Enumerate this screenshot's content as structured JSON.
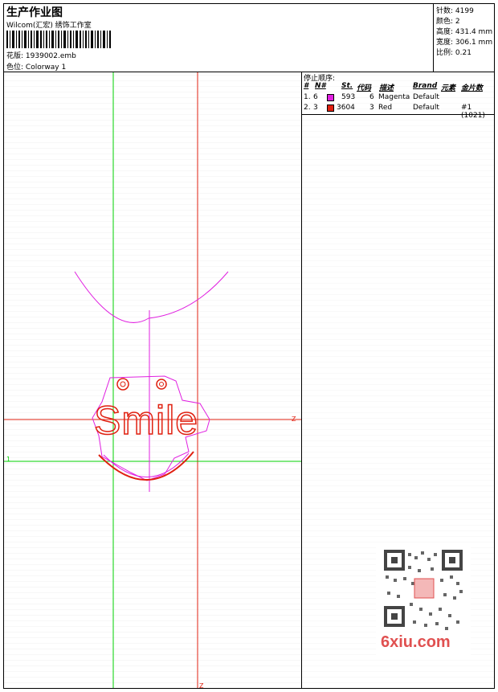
{
  "header": {
    "title": "生产作业图",
    "studio": "Wilcom(汇宏) 绣饰工作室",
    "design_label": "花版:",
    "design_file": "1939002.emb",
    "colorway_label": "色位:",
    "colorway": "Colorway 1"
  },
  "stats": {
    "stitches_label": "针数:",
    "stitches": "4199",
    "colors_label": "颜色:",
    "colors": "2",
    "height_label": "高度:",
    "height": "431.4 mm",
    "width_label": "宽度:",
    "width": "306.1 mm",
    "scale_label": "比例:",
    "scale": "0.21"
  },
  "stop_sequence": {
    "title": "停止顺序:",
    "headers": [
      "#",
      "N#",
      "St.",
      "代码",
      "描述",
      "Brand",
      "元素",
      "金片数"
    ],
    "rows": [
      {
        "idx": "1.",
        "n": "6",
        "color": "#e020e0",
        "st": "593",
        "code": "6",
        "desc": "Magenta",
        "brand": "Default",
        "element": "",
        "sequins": ""
      },
      {
        "idx": "2.",
        "n": "3",
        "color": "#e02010",
        "st": "3604",
        "code": "3",
        "desc": "Red",
        "brand": "Default",
        "element": "",
        "sequins": "#1 (1021)"
      }
    ]
  },
  "design_text": "Smile",
  "axis_labels": {
    "z_right": "Z",
    "z_bottom": "Z",
    "one_left": "1"
  },
  "watermark": "6xiu.com",
  "colors": {
    "magenta": "#e020e0",
    "red": "#e02010",
    "green": "#00d000"
  }
}
